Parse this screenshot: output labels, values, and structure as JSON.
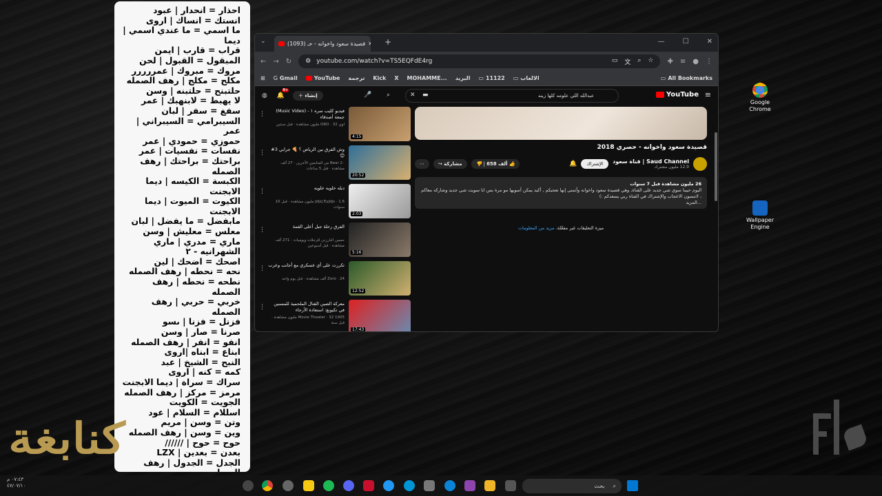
{
  "notepad_lines": [
    "احذار = انحدار | عبود",
    "انستك = انساك | اروى",
    "ما اسمي = ما عندي اسمي | ديما",
    "قراب = قارب | ايمن",
    "المبقول = القبول | لحن",
    "مروك = مبروك | عمررررر",
    "مكلح = مكلج | رهف الصمله",
    "حلتبنح = حلتبنه | وسن",
    "لا يهبط = لابنهبك | عمر",
    "سفغ = سفر | لبان",
    "السيبرامي = السيبراني | عمر",
    "حموزي = حمودي | عمر",
    "نفسات = نفسيات | عمر",
    "براحتك = براحتك | رهف الصمله",
    "الكبسة = الكيسه | ديما الابجنت",
    "الكيوت = الميوت | ديما الابجنت",
    "مابفضل = ما يفضل | لبان",
    "معلس = معليش | وسن",
    "ماري = مدري | ماري الشهرانيه - ٢",
    "اصحك = اضحك | لين",
    "نحه = نحطه | رهف الصمله",
    "نطحه = نحطه | رهف الصمله",
    "خربي = حربي | رهف الصمله",
    "فزنل = فزنا | ىسو",
    "صرنا = صار | وسن",
    "انفو = انفر | رهف الصمله",
    "ابناع = ابناه |اروى",
    "النبح = الشيخ | عبد",
    "كمه = كنه | اروى",
    "سراك = سراة | ديما الابجنت",
    "مرمز = مركز | رهف الصمله",
    "الجويت = الكويت",
    "اسللام = السلام | عود",
    "وتن = وسن | مريم",
    "وين = وسن | رهف الصمله",
    "حوح = حوح | //////",
    "بعدن = بعدين | LZX",
    "الجدل = الجدول | رهف الصمله"
  ],
  "browser": {
    "tab_title": "(1093) قصيدة سعود واخوانه - حـ",
    "new_tab": "+",
    "url": "youtube.com/watch?v=TS5EQFdE4rg",
    "bookmarks": [
      "Gmail",
      "YouTube",
      "ترجمة",
      "Kick",
      "X",
      "MOHAMME...",
      "البريد",
      "11122",
      "الالعاب"
    ],
    "all_bookmarks": "All Bookmarks"
  },
  "youtube": {
    "logo": "YouTube",
    "search_query": "عبدالله اللي علومه كلها زينه",
    "create_label": "إنشاء",
    "notif_count": "9+",
    "video_title": "قصيدة سعود واخوانه - حصري 2018",
    "channel_name": "Saud Channel | قناة سعود",
    "subscribers": "12.9 مليون مشترك",
    "subscribe_label": "الإشتراك",
    "like_count": "658 ألف",
    "share_label": "مشاركة",
    "views_line": "26 مليون مشاهدة  قبل 7 سنوات",
    "description": "اليوم حبينا سوي شي جديد على القناة, وهي قصيدة سعود واخوانه وأتمنى إنها تعجبكم , أكيد يمكن أسويها مو مرة بس انا سويت شي جديد وشاركه معاكم ، لاتنسون الاعجاب والإشتراك في القناة ربي يسعدكم :)",
    "more": "...المزيد",
    "comments_off": "ميزة التعليقات غير مفعّلة.",
    "learn_more": "مزيد من المعلومات",
    "sidebar": [
      {
        "title": "فيديو كليب سره ١ - (Music Video) جمعة أصدقاء",
        "meta": "اوي ORO · 32 مليون مشاهدة · قبل سنتين",
        "duration": "4:15"
      },
      {
        "title": "وش الفرق بين الرياض ؟ 🍕 جرابي 3# 😊",
        "meta": "Bear 2٠ من المتابعين الآخرين · 27 ألف مشاهدة · قبل 5 ساعات",
        "duration": "20:52"
      },
      {
        "title": "ديله خلويه خلويه",
        "meta": "Jdjsj Eyjdjs · 1.6 مليون مشاهدة · قبل 10 سنوات",
        "duration": "2:03"
      },
      {
        "title": "الفرق رحلة جبل أعلى القمة",
        "meta": "حسين البارزني للرحلات ويوميات · 271 ألف مشاهدة · قبل أسبوعين",
        "duration": "5:16"
      },
      {
        "title": "تكررت على أي عسكري مع أجانب وعرب",
        "meta": "Zoro · 24 ألف مشاهدة · قبل يوم واحد",
        "duration": "12:52"
      },
      {
        "title": "معركة الصين القتال الملحمية للمسنين في تكيونغ: استعادة الأرجاء",
        "meta": "1905 Movie Theater · 32 مليون مشاهدة · قبل سنة",
        "duration": "17:43"
      }
    ]
  },
  "desktop_icons": [
    "Google Chrome",
    "Wallpaper Engine"
  ],
  "taskbar": {
    "search_placeholder": "بحث"
  },
  "clock": {
    "time": "٠٧:٤٣ م",
    "date": "٤٧/٠٧/١٠"
  },
  "logo_text": "كنابغة",
  "colors": {
    "youtube_red": "#ff0000",
    "notepad_bg": "#f7f7f7",
    "logo_gold": "#b99a52"
  }
}
